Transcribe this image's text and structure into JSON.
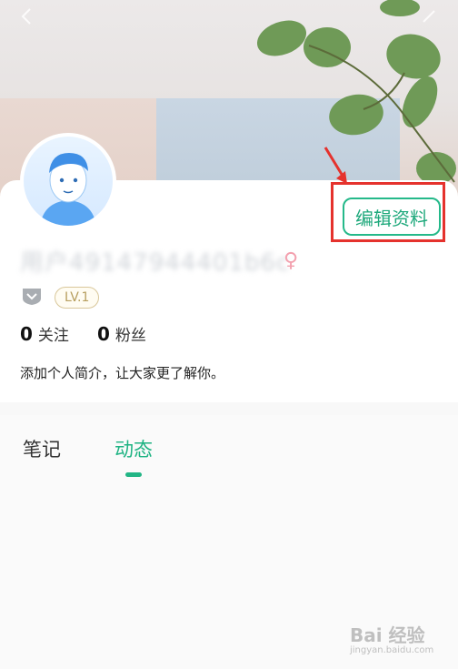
{
  "profile": {
    "username": "用户49147944401b6c",
    "gender_symbol": "♀",
    "level": "LV.1",
    "following_count": "0",
    "following_label": "关注",
    "followers_count": "0",
    "followers_label": "粉丝",
    "bio": "添加个人简介，让大家更了解你。",
    "edit_label": "编辑资料"
  },
  "tabs": [
    {
      "label": "笔记",
      "active": false
    },
    {
      "label": "动态",
      "active": true
    }
  ],
  "watermark": {
    "brand": "Bai 经验",
    "url": "jingyan.baidu.com"
  },
  "icons": {
    "back": "chevron-left-icon",
    "share": "share-icon",
    "gender": "female-icon",
    "badge": "shield-badge-icon",
    "avatar": "avatar"
  },
  "colors": {
    "accent": "#22b585",
    "highlight": "#e5322d",
    "level_border": "#d9c79a",
    "gender": "#f3a0ae"
  }
}
